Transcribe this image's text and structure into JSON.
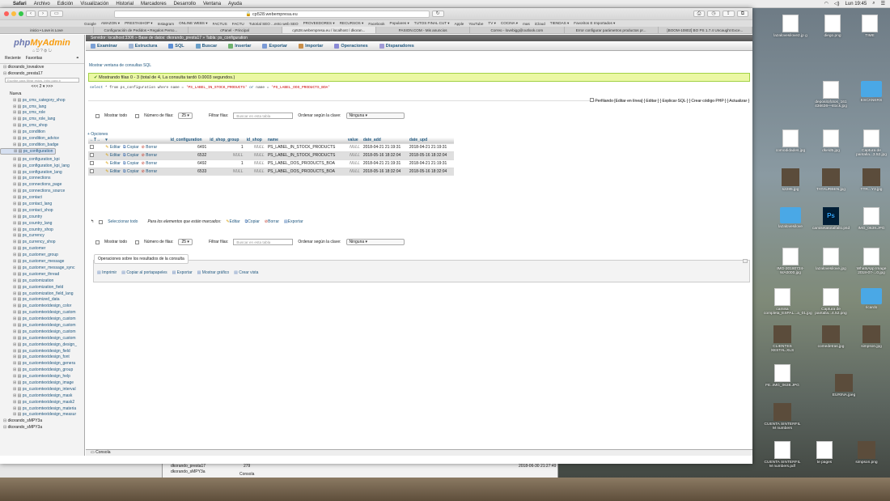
{
  "menubar": {
    "apple": "",
    "items": [
      "Safari",
      "Archivo",
      "Edición",
      "Visualización",
      "Historial",
      "Marcadores",
      "Desarrollo",
      "Ventana",
      "Ayuda"
    ],
    "clock": "Lun 19:45"
  },
  "browser": {
    "url": "cp528.webempresa.eu",
    "bookmarks": [
      "Google",
      "AMAZON ▾",
      "PRESTASHOP ▾",
      "Instagram",
      "ONLINE WEBS ▾",
      "FACTUS",
      "FACTU",
      "Tutorial SEO ...ento web SEO",
      "PROVEEDORES ▾",
      "RECURSOS ▾",
      "Facebook",
      "Populares ▾",
      "TUTOS FINAL CUT ▾",
      "Apple",
      "YouTube",
      "TV ▾",
      "COCINA ▾",
      "mas",
      "iCloud",
      "TIENDAS ▾",
      "Favoritos E Importados ▾"
    ],
    "tabs": [
      "inicio • Love is Love",
      "Configuración de Pedidos • Regalos Perso...",
      "cPanel - Principal",
      "cp528.webempresa.eu / localhost / dkoran...",
      "PASION.COM - Mis anuncios",
      "Correo - lovebigg@outlook.com",
      "Error configurar parámetros productos pr...",
      "[BOOM-10802] BO PS 1.7.4 Uncaught Exce..."
    ]
  },
  "pma": {
    "logo_php": "php",
    "logo_admin": "MyAdmin",
    "side_tabs": [
      "Reciente",
      "Favoritas"
    ],
    "filter_placeholder": "Escribe para filtrar estos, Intro para b",
    "pager": "<<<   2 ▾  >>>",
    "databases_top": [
      "dkorando_lovealove",
      "dkorando_presta17"
    ],
    "new_label": "Nueva",
    "tables": [
      "ps_cms_category_shop",
      "ps_cms_lang",
      "ps_cms_role",
      "ps_cms_role_lang",
      "ps_cms_shop",
      "ps_condition",
      "ps_condition_advice",
      "ps_condition_badge",
      "ps_configuration",
      "ps_configuration_kpi",
      "ps_configuration_kpi_lang",
      "ps_configuration_lang",
      "ps_connections",
      "ps_connections_page",
      "ps_connections_source",
      "ps_contact",
      "ps_contact_lang",
      "ps_contact_shop",
      "ps_country",
      "ps_country_lang",
      "ps_country_shop",
      "ps_currency",
      "ps_currency_shop",
      "ps_customer",
      "ps_customer_group",
      "ps_customer_message",
      "ps_customer_message_sync",
      "ps_customer_thread",
      "ps_customization",
      "ps_customization_field",
      "ps_customization_field_lang",
      "ps_customized_data",
      "ps_customtextdesign_color",
      "ps_customtextdesign_custom",
      "ps_customtextdesign_custom",
      "ps_customtextdesign_custom",
      "ps_customtextdesign_custom",
      "ps_customtextdesign_custom",
      "ps_customtextdesign_design_",
      "ps_customtextdesign_field",
      "ps_customtextdesign_font",
      "ps_customtextdesign_genera",
      "ps_customtextdesign_group",
      "ps_customtextdesign_help",
      "ps_customtextdesign_image",
      "ps_customtextdesign_interval",
      "ps_customtextdesign_mask",
      "ps_customtextdesign_mask2",
      "ps_customtextdesign_materia",
      "ps_customtextdesign_measur"
    ],
    "databases_bottom": [
      "dkorando_sMPY3a",
      "dkorando_sMPY3a"
    ],
    "breadcrumb": "Servidor: localhost:3306 » Base de datos: dkorando_presta17 » Tabla: ps_configuration",
    "tabs": [
      "Examinar",
      "Estructura",
      "SQL",
      "Buscar",
      "Insertar",
      "Exportar",
      "Importar",
      "Operaciones",
      "Disparadores"
    ],
    "show_sql": "Mostrar ventana de consultas SQL",
    "success": "Mostrando filas 0 - 3 (total de 4, La consulta tardó 0.0003 segundos.)",
    "sql_select": "select",
    "sql_body": " * from ps_configuration where name = ",
    "sql_str1": "'PS_LABEL_IN_STOCK_PRODUCTS'",
    "sql_or": " or ",
    "sql_name": "name = ",
    "sql_str2": "'PS_LABEL_OOS_PRODUCTS_BOA'",
    "profiling": "Perfilando [Editar en línea] [ Editar ] [ Explicar SQL ] [ Crear código PHP ] [ Actualizar ]",
    "show_all": "Mostrar todo",
    "rows_label": "Número de filas:",
    "rows_value": "25 ▾",
    "filter_label": "Filtrar filas:",
    "filter_ph": "Buscar en esta tabla",
    "sort_label": "Ordenar según la clave:",
    "sort_value": "Ninguna ▾",
    "options": "+ Opciones",
    "columns": [
      "id_configuration",
      "id_shop_group",
      "id_shop",
      "name",
      "value",
      "date_add",
      "date_upd"
    ],
    "rows": [
      {
        "id": "6491",
        "group": "1",
        "shop": "NULL",
        "name": "PS_LABEL_IN_STOCK_PRODUCTS",
        "value": "NULL",
        "add": "2018-04-21 21:19:31",
        "upd": "2018-04-21 21:19:31"
      },
      {
        "id": "6532",
        "group": "NULL",
        "shop": "NULL",
        "name": "PS_LABEL_IN_STOCK_PRODUCTS",
        "value": "NULL",
        "add": "2018-05-16 18:32:04",
        "upd": "2018-05-16 18:32:04"
      },
      {
        "id": "6492",
        "group": "1",
        "shop": "NULL",
        "name": "PS_LABEL_OOS_PRODUCTS_BOA",
        "value": "NULL",
        "add": "2018-04-21 21:19:31",
        "upd": "2018-04-21 21:19:31"
      },
      {
        "id": "6533",
        "group": "NULL",
        "shop": "NULL",
        "name": "PS_LABEL_OOS_PRODUCTS_BOA",
        "value": "NULL",
        "add": "2018-05-16 18:32:04",
        "upd": "2018-05-16 18:32:04"
      }
    ],
    "act_edit": "Editar",
    "act_copy": "Copiar",
    "act_delete": "Borrar",
    "select_all": "Seleccionar todo",
    "for_selected": "Para los elementos que están marcados:",
    "sel_edit": "Editar",
    "sel_copy": "Copiar",
    "sel_delete": "Borrar",
    "sel_export": "Exportar",
    "ops_title": "Operaciones sobre los resultados de la consulta",
    "ops": [
      "Imprimir",
      "Copiar al portapapeles",
      "Exportar",
      "Mostrar gráfico",
      "Crear vista"
    ],
    "console": "Consola"
  },
  "desktop": [
    "lazalovesilove2.jp g",
    "diego.png",
    "TIME",
    "depositofotos_161 436636—stock.jpg",
    "ESCANERS",
    "comodidades.jpg",
    "dkeld5.jpg",
    "Captura de pantalla...3.52.jpg",
    "s2285.jpg",
    "TATAURBEN.jpg",
    "TTR...Y3.jpg",
    "lazalovesilove",
    "camisetatotalfallo.psd",
    "IMG_0639.JPG",
    "IMG-20180724-WA0000.jpg",
    "lazalovesilove.jpg",
    "WhatsApp Image 2018-07-...0.jpg",
    "camisa completa_ESPAL...a_01.jpg",
    "Captura de pantalla...4.52.png",
    "ricardo",
    "CLIENTES XESTAL.XLS",
    "comedetras.jpg",
    "simpson.jpg",
    "FE..IMG_0638.JPG",
    "EURINA.jpeg",
    "CUENTA SINTERFIL M numbers",
    "CUENTA SINTERFIL M numbers.pdf",
    "te pages",
    "simpson.png"
  ],
  "bgwin": {
    "rows": [
      "dkorando_presta17",
      "dkorando_sMPY3a"
    ],
    "console": "Consola",
    "row_date": "2018-06-30 21:27:49",
    "row_num": "279"
  }
}
